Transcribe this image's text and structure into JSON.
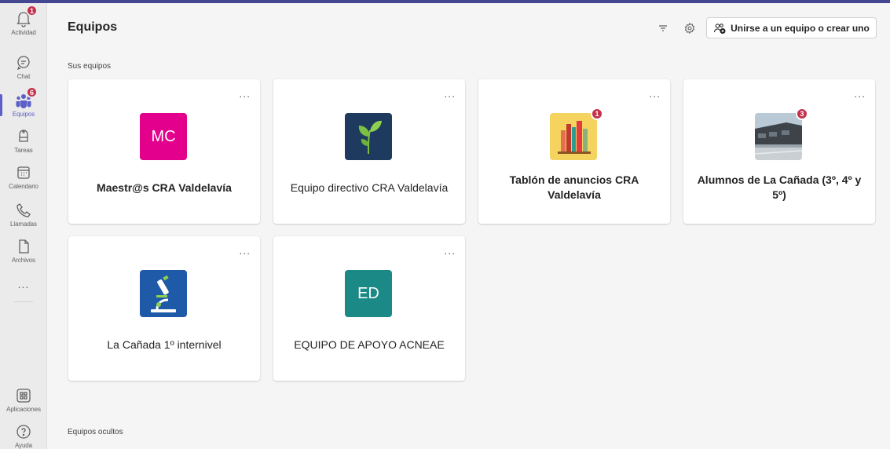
{
  "rail": {
    "items": [
      {
        "label": "Actividad",
        "icon": "bell-icon",
        "badge": "1"
      },
      {
        "label": "Chat",
        "icon": "chat-icon"
      },
      {
        "label": "Equipos",
        "icon": "teams-icon",
        "badge": "6"
      },
      {
        "label": "Tareas",
        "icon": "assignments-icon"
      },
      {
        "label": "Calendario",
        "icon": "calendar-icon"
      },
      {
        "label": "Llamadas",
        "icon": "phone-icon"
      },
      {
        "label": "Archivos",
        "icon": "file-icon"
      }
    ],
    "more": "...",
    "bottom": [
      {
        "label": "Aplicaciones",
        "icon": "apps-icon"
      },
      {
        "label": "Ayuda",
        "icon": "help-icon"
      }
    ]
  },
  "header": {
    "title": "Equipos",
    "join_button": "Unirse a un equipo o crear uno"
  },
  "sections": {
    "your_teams": "Sus equipos",
    "hidden_teams": "Equipos ocultos"
  },
  "teams": [
    {
      "name": "Maestr@s CRA Valdelavía",
      "initials": "MC",
      "color": "#e3008c",
      "bold": true
    },
    {
      "name": "Equipo directivo CRA Valdelavía",
      "image": "leaf-image",
      "color": "#1e3a5f",
      "bold": false
    },
    {
      "name": "Tablón de anuncios CRA Valdelavía",
      "image": "books-image",
      "color": "#f4d35e",
      "badge": "1",
      "bold": true
    },
    {
      "name": "Alumnos de La Cañada (3º, 4º y 5º)",
      "image": "school-building-image",
      "badge": "3",
      "bold": true
    },
    {
      "name": "La Cañada 1º internivel",
      "image": "microscope-image",
      "color": "#1e5aa8",
      "bold": false
    },
    {
      "name": "EQUIPO DE APOYO ACNEAE",
      "initials": "ED",
      "color": "#1b8a86",
      "bold": false
    }
  ],
  "card_more": "..."
}
